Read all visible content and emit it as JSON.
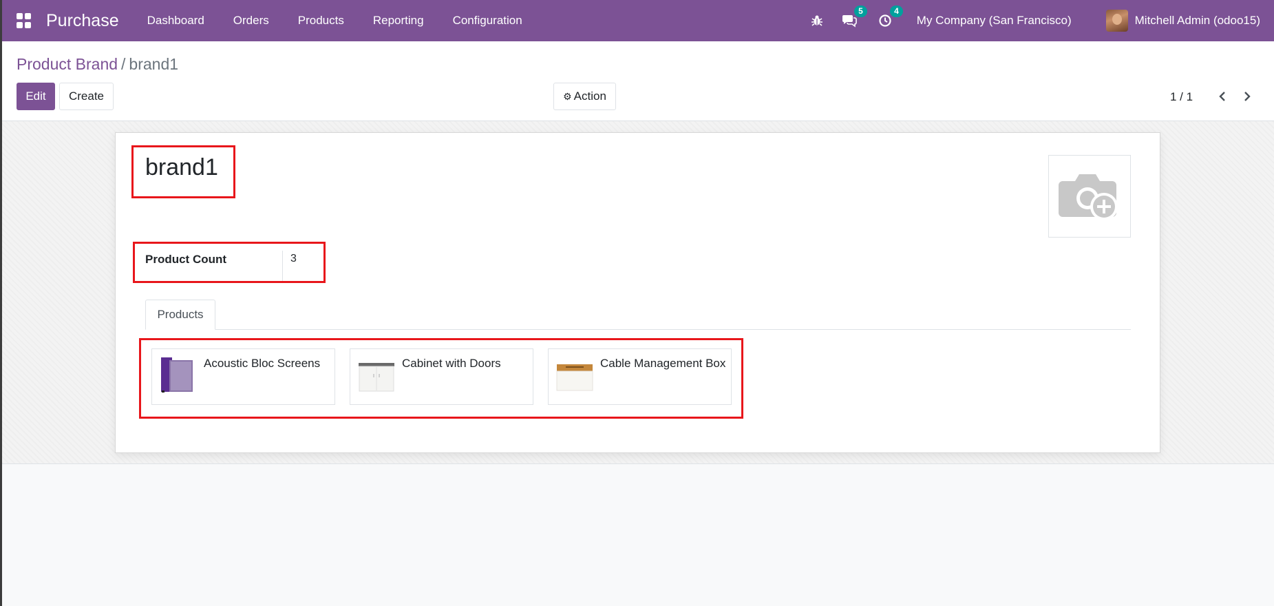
{
  "app": {
    "name": "Purchase"
  },
  "nav": {
    "menu": [
      {
        "label": "Dashboard"
      },
      {
        "label": "Orders"
      },
      {
        "label": "Products"
      },
      {
        "label": "Reporting"
      },
      {
        "label": "Configuration"
      }
    ],
    "messages_badge": "5",
    "activities_badge": "4",
    "company": "My Company (San Francisco)",
    "user": "Mitchell Admin (odoo15)"
  },
  "breadcrumb": {
    "parent": "Product Brand",
    "separator": "/",
    "current": "brand1"
  },
  "buttons": {
    "edit": "Edit",
    "create": "Create",
    "action": "Action"
  },
  "pager": {
    "value": "1 / 1"
  },
  "record": {
    "name": "brand1",
    "product_count_label": "Product Count",
    "product_count_value": "3"
  },
  "tabs": [
    {
      "label": "Products"
    }
  ],
  "products": [
    {
      "name": "Acoustic Bloc Screens",
      "image_icon": "purple-panel-screen"
    },
    {
      "name": "Cabinet with Doors",
      "image_icon": "white-cabinet"
    },
    {
      "name": "Cable Management Box",
      "image_icon": "cable-box"
    }
  ],
  "colors": {
    "brand": "#7c5295",
    "badge": "#00a09d",
    "highlight": "#e8161b"
  },
  "icons": {
    "apps": "apps-grid-icon",
    "debug": "bug-icon",
    "messages": "chat-icon",
    "activities": "clock-icon",
    "action": "gear-icon",
    "pager_prev": "chevron-left-icon",
    "pager_next": "chevron-right-icon",
    "image_placeholder": "camera-plus-icon"
  }
}
